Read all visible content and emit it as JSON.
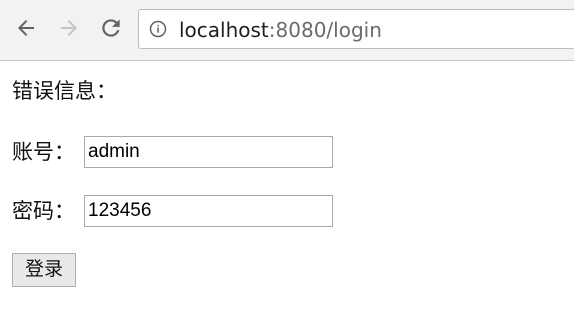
{
  "browser": {
    "url_host": "localhost",
    "url_rest": ":8080/login",
    "icons": {
      "back": "arrow-left-icon",
      "forward": "arrow-right-icon",
      "reload": "reload-icon",
      "info": "info-circle-icon"
    }
  },
  "page": {
    "error_label": "错误信息：",
    "account_label": "账号：",
    "account_value": "admin",
    "password_label": "密码：",
    "password_value": "123456",
    "submit_label": "登录"
  }
}
